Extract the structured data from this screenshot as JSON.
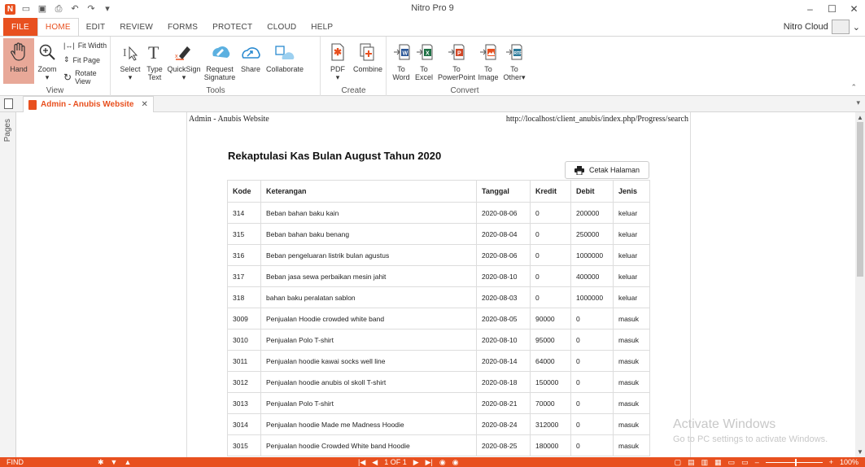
{
  "window": {
    "title": "Nitro Pro 9",
    "minimize": "–",
    "maximize": "☐",
    "close": "✕"
  },
  "ribbon_tabs": [
    "FILE",
    "HOME",
    "EDIT",
    "REVIEW",
    "FORMS",
    "PROTECT",
    "CLOUD",
    "HELP"
  ],
  "active_tab": "HOME",
  "account": {
    "label": "Nitro Cloud",
    "caret": "⌄"
  },
  "ribbon": {
    "view": {
      "label": "View",
      "hand": "Hand",
      "zoom": "Zoom",
      "fit_width": "Fit Width",
      "fit_page": "Fit Page",
      "rotate_view": "Rotate View"
    },
    "tools": {
      "label": "Tools",
      "select": "Select",
      "type_text_1": "Type",
      "type_text_2": "Text",
      "quicksign": "QuickSign",
      "request_1": "Request",
      "request_2": "Signature",
      "share": "Share",
      "collaborate": "Collaborate"
    },
    "create": {
      "label": "Create",
      "pdf": "PDF",
      "combine": "Combine"
    },
    "convert": {
      "label": "Convert",
      "to_word_1": "To",
      "to_word_2": "Word",
      "to_excel_1": "To",
      "to_excel_2": "Excel",
      "to_ppt_1": "To",
      "to_ppt_2": "PowerPoint",
      "to_image_1": "To",
      "to_image_2": "Image",
      "to_other_1": "To",
      "to_other_2": "Other▾"
    }
  },
  "document_tab": {
    "title": "Admin - Anubis Website",
    "close": "✕"
  },
  "side_panel": {
    "pages_label": "Pages"
  },
  "page": {
    "header_left": "Admin - Anubis Website",
    "header_right": "http://localhost/client_anubis/index.php/Progress/search",
    "title": "Rekaptulasi Kas Bulan August Tahun 2020",
    "print_button": "Cetak Halaman",
    "table": {
      "headers": [
        "Kode",
        "Keterangan",
        "Tanggal",
        "Kredit",
        "Debit",
        "Jenis"
      ],
      "rows": [
        [
          "314",
          "Beban bahan baku kain",
          "2020-08-06",
          "0",
          "200000",
          "keluar"
        ],
        [
          "315",
          "Beban bahan baku benang",
          "2020-08-04",
          "0",
          "250000",
          "keluar"
        ],
        [
          "316",
          "Beban pengeluaran listrik bulan agustus",
          "2020-08-06",
          "0",
          "1000000",
          "keluar"
        ],
        [
          "317",
          "Beban jasa sewa perbaikan mesin jahit",
          "2020-08-10",
          "0",
          "400000",
          "keluar"
        ],
        [
          "318",
          "bahan baku peralatan sablon",
          "2020-08-03",
          "0",
          "1000000",
          "keluar"
        ],
        [
          "3009",
          "Penjualan Hoodie crowded white band",
          "2020-08-05",
          "90000",
          "0",
          "masuk"
        ],
        [
          "3010",
          "Penjualan Polo T-shirt",
          "2020-08-10",
          "95000",
          "0",
          "masuk"
        ],
        [
          "3011",
          "Penjualan hoodie kawai socks well line",
          "2020-08-14",
          "64000",
          "0",
          "masuk"
        ],
        [
          "3012",
          "Penjualan hoodie anubis ol skoll T-shirt",
          "2020-08-18",
          "150000",
          "0",
          "masuk"
        ],
        [
          "3013",
          "Penjualan Polo T-shirt",
          "2020-08-21",
          "70000",
          "0",
          "masuk"
        ],
        [
          "3014",
          "Penjualan hoodie Made me Madness Hoodie",
          "2020-08-24",
          "312000",
          "0",
          "masuk"
        ],
        [
          "3015",
          "Penjualan hoodie Crowded White band Hoodie",
          "2020-08-25",
          "180000",
          "0",
          "masuk"
        ]
      ]
    }
  },
  "watermark": {
    "line1": "Activate Windows",
    "line2": "Go to PC settings to activate Windows."
  },
  "statusbar": {
    "find": "FIND",
    "page_indicator": "1 OF 1",
    "zoom": "100%",
    "minus": "–",
    "plus": "+"
  },
  "colors": {
    "accent": "#e8501f"
  }
}
